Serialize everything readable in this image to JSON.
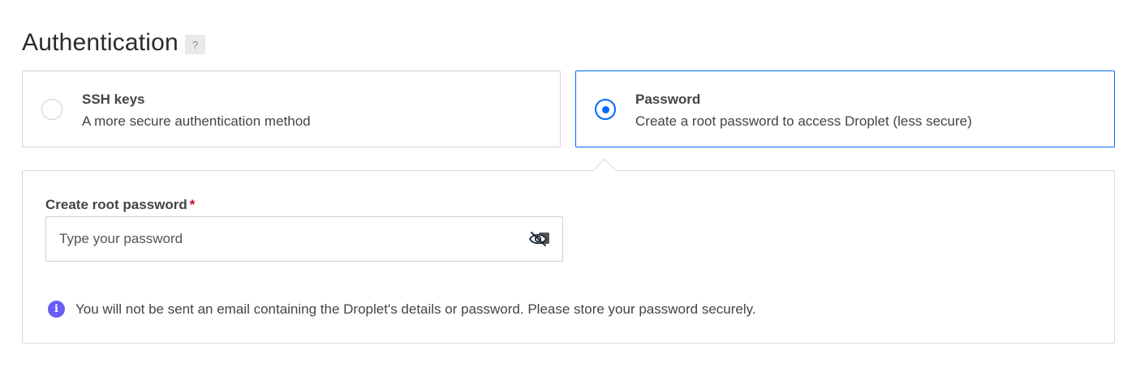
{
  "section": {
    "title": "Authentication",
    "help_label": "?"
  },
  "options": [
    {
      "title": "SSH keys",
      "description": "A more secure authentication method",
      "selected": false
    },
    {
      "title": "Password",
      "description": "Create a root password to access Droplet (less secure)",
      "selected": true
    }
  ],
  "password_panel": {
    "label": "Create root password",
    "required_marker": "*",
    "input_value": "",
    "input_placeholder": "Type your password",
    "toggle_icon": "eye-slash-icon",
    "info_icon": "info-icon",
    "info_text": "You will not be sent an email containing the Droplet's details or password. Please store your password securely."
  },
  "colors": {
    "accent": "#0069ff",
    "info": "#6a5cf6",
    "required": "#d0021b"
  }
}
